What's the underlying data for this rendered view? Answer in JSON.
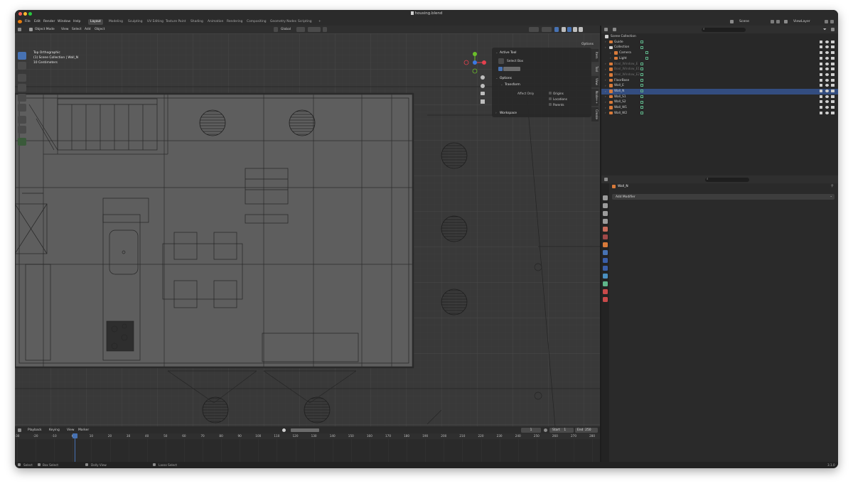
{
  "window": {
    "title": "housing.blend"
  },
  "menu": [
    "File",
    "Edit",
    "Render",
    "Window",
    "Help"
  ],
  "workspaces": [
    {
      "label": "Layout",
      "active": true
    },
    {
      "label": "Modeling"
    },
    {
      "label": "Sculpting"
    },
    {
      "label": "UV Editing"
    },
    {
      "label": "Texture Paint"
    },
    {
      "label": "Shading"
    },
    {
      "label": "Animation"
    },
    {
      "label": "Rendering"
    },
    {
      "label": "Compositing"
    },
    {
      "label": "Geometry Nodes"
    },
    {
      "label": "Scripting"
    },
    {
      "label": "+"
    }
  ],
  "top_right": {
    "scene": "Scene",
    "view_layer": "ViewLayer"
  },
  "viewport_header": {
    "mode": "Object Mode",
    "view": "View",
    "select": "Select",
    "add": "Add",
    "object": "Object",
    "transform": "Global",
    "options": "Options"
  },
  "overlay": {
    "view_name": "Top Orthographic",
    "collection": "(1) Scene Collection | Wall_N",
    "scale": "10 Centimeters"
  },
  "npanel": {
    "active_tool": "Active Tool",
    "select_box": "Select Box",
    "options": "Options",
    "transform": "Transform",
    "affect_only": "Affect Only",
    "origins": "Origins",
    "locations": "Locations",
    "parents": "Parents",
    "workspace": "Workspace",
    "tabs": [
      "Item",
      "Tool",
      "View",
      "Node++",
      "Create"
    ]
  },
  "outliner": {
    "root": "Scene Collection",
    "rows": [
      {
        "label": "Guide",
        "indent": 1,
        "color": "#d87a3a"
      },
      {
        "label": "Collection",
        "indent": 1,
        "color": "#d0d0d0"
      },
      {
        "label": "Camera",
        "indent": 2,
        "color": "#d87a3a"
      },
      {
        "label": "Light",
        "indent": 2,
        "color": "#d87a3a"
      },
      {
        "label": "Bool_Window_E",
        "indent": 1,
        "color": "#d87a3a",
        "dim": true
      },
      {
        "label": "Bool_Window_E1",
        "indent": 1,
        "color": "#d87a3a",
        "dim": true
      },
      {
        "label": "Bool_Window_E2",
        "indent": 1,
        "color": "#d87a3a",
        "dim": true
      },
      {
        "label": "FloorBase",
        "indent": 1,
        "color": "#d87a3a"
      },
      {
        "label": "Wall_E",
        "indent": 1,
        "color": "#d87a3a"
      },
      {
        "label": "Wall_N",
        "indent": 1,
        "color": "#d87a3a",
        "selected": true
      },
      {
        "label": "Wall_S1",
        "indent": 1,
        "color": "#d87a3a"
      },
      {
        "label": "Wall_S2",
        "indent": 1,
        "color": "#d87a3a"
      },
      {
        "label": "Wall_W1",
        "indent": 1,
        "color": "#d87a3a"
      },
      {
        "label": "Wall_W2",
        "indent": 1,
        "color": "#d87a3a"
      }
    ]
  },
  "properties": {
    "object_name": "Wall_N",
    "add_modifier": "Add Modifier"
  },
  "timeline": {
    "playback": "Playback",
    "keying": "Keying",
    "view": "View",
    "marker": "Marker",
    "current_frame": "1",
    "start_label": "Start",
    "start": "1",
    "end_label": "End",
    "end": "250",
    "ticks": [
      "-30",
      "-20",
      "-10",
      "0",
      "10",
      "20",
      "30",
      "40",
      "50",
      "60",
      "70",
      "80",
      "90",
      "100",
      "110",
      "120",
      "130",
      "140",
      "150",
      "160",
      "170",
      "180",
      "190",
      "200",
      "210",
      "220",
      "230",
      "240",
      "250",
      "260",
      "270",
      "280"
    ]
  },
  "status": {
    "select": "Select",
    "box_select": "Box Select",
    "dolly_view": "Dolly View",
    "lasso_select": "Lasso Select",
    "version": "3.1.0"
  },
  "colors": {
    "accent": "#4772b3",
    "object_orange": "#d87a3a",
    "selected_row": "#334d80",
    "mesh_green": "#5fb58a"
  }
}
